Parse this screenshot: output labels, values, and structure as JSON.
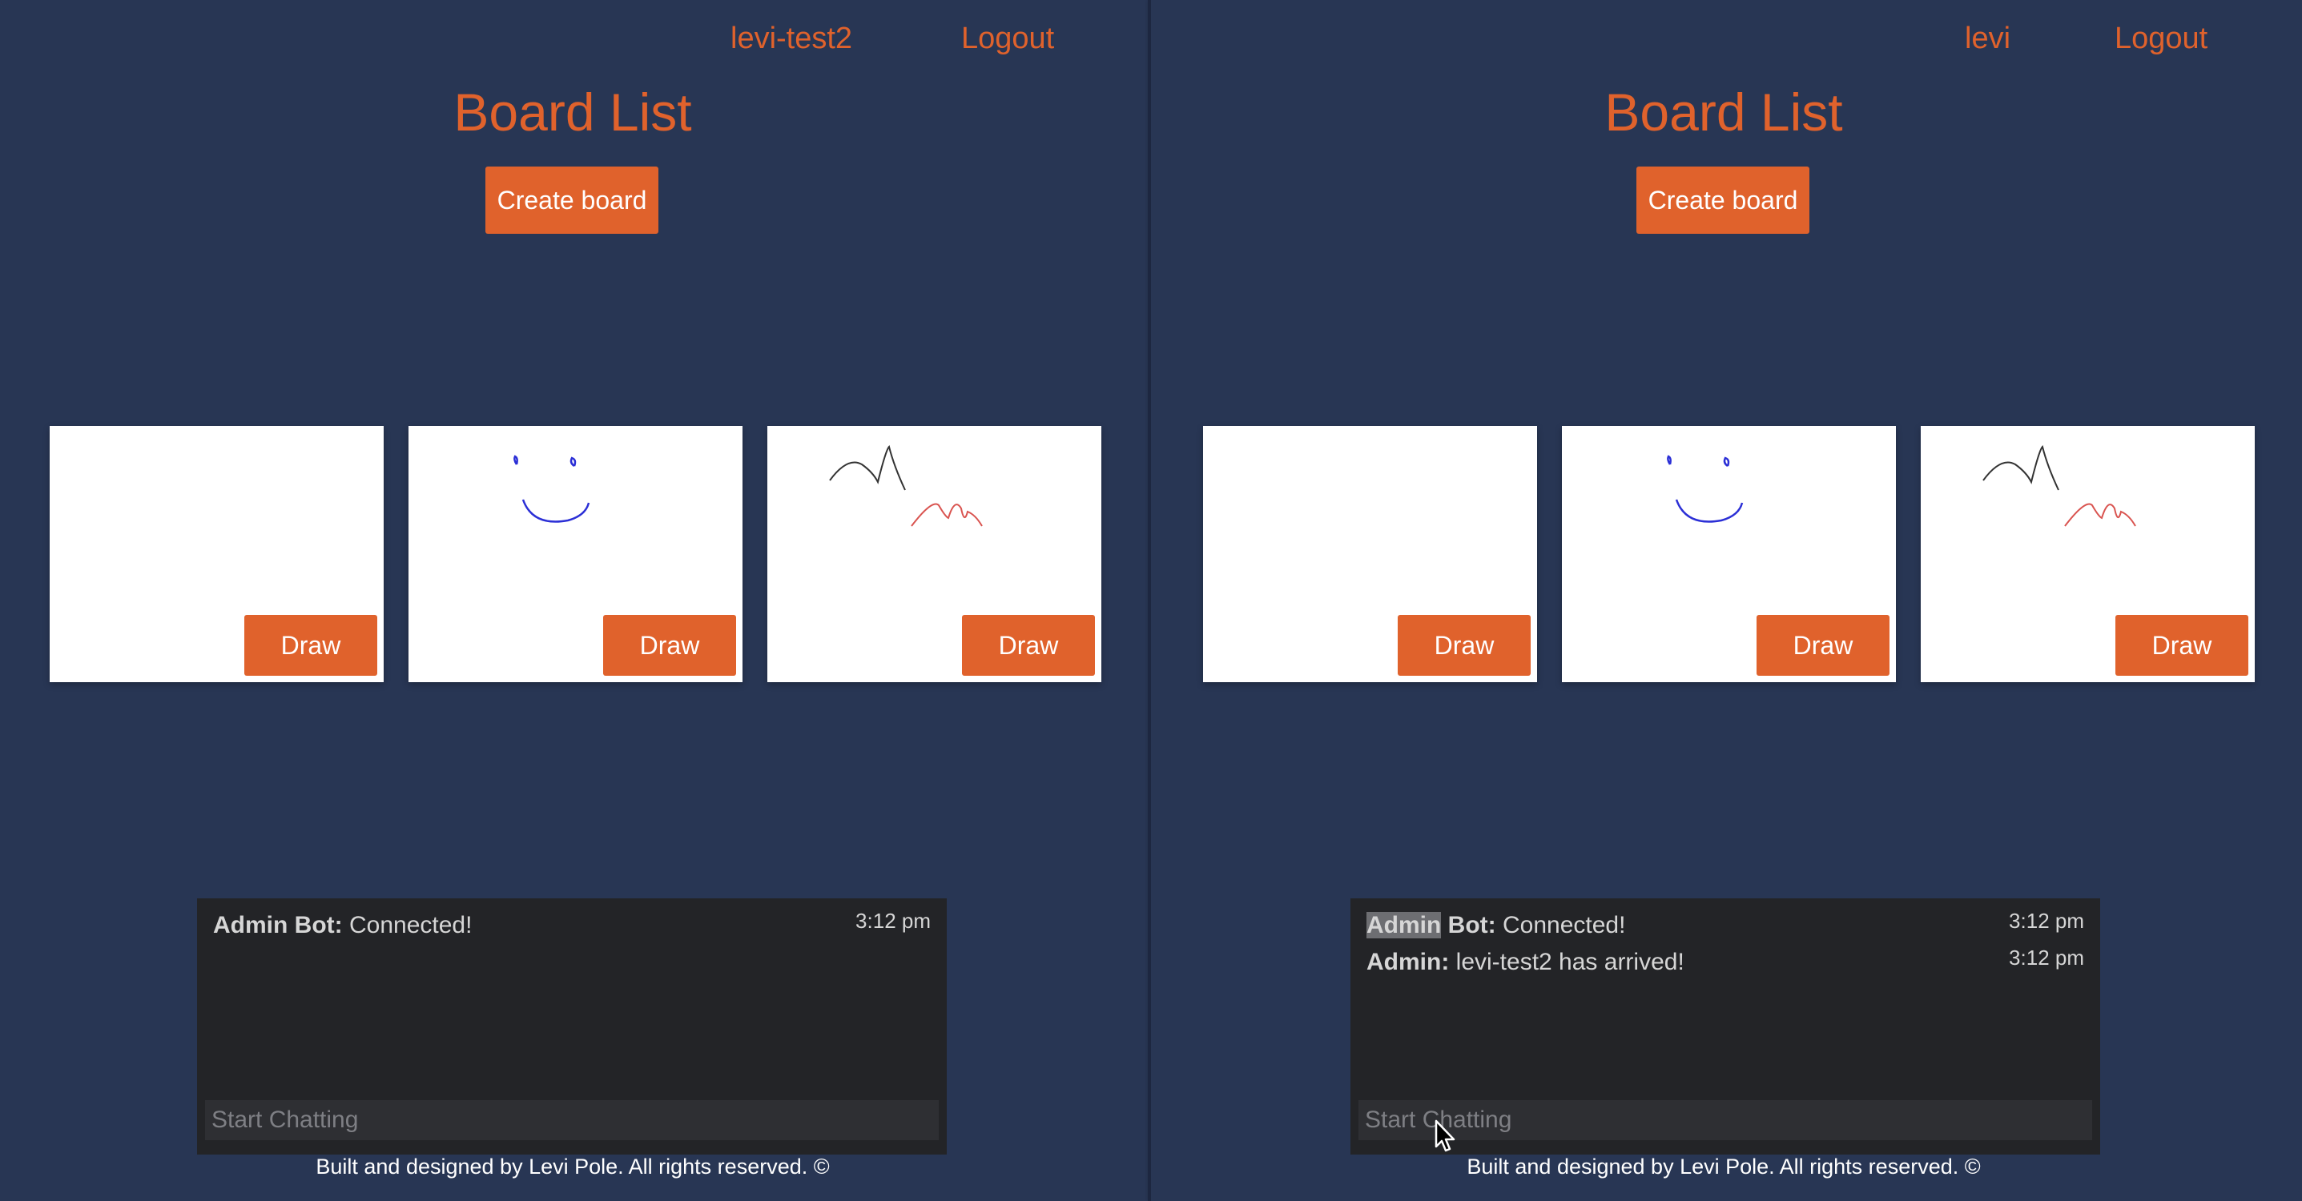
{
  "windows": [
    {
      "nav": {
        "username": "levi-test2",
        "logout": "Logout"
      },
      "title": "Board List",
      "create_button": "Create board",
      "boards": [
        {
          "draw_label": "Draw",
          "sketch": "blank"
        },
        {
          "draw_label": "Draw",
          "sketch": "smiley"
        },
        {
          "draw_label": "Draw",
          "sketch": "scribbles"
        }
      ],
      "chat": {
        "messages": [
          {
            "sender": "Admin Bot:",
            "text": "Connected!",
            "time": "3:12 pm"
          }
        ],
        "input_placeholder": "Start Chatting"
      },
      "footer": "Built and designed by Levi Pole. All rights reserved. ©"
    },
    {
      "nav": {
        "username": "levi",
        "logout": "Logout"
      },
      "title": "Board List",
      "create_button": "Create board",
      "boards": [
        {
          "draw_label": "Draw",
          "sketch": "blank"
        },
        {
          "draw_label": "Draw",
          "sketch": "smiley"
        },
        {
          "draw_label": "Draw",
          "sketch": "scribbles"
        }
      ],
      "chat": {
        "messages": [
          {
            "sender_highlight": "Admin",
            "sender": " Bot:",
            "text": "Connected!",
            "time": "3:12 pm"
          },
          {
            "sender": "Admin:",
            "text": "levi-test2 has arrived!",
            "time": "3:12 pm"
          }
        ],
        "input_placeholder": "Start Chatting"
      },
      "footer": "Built and designed by Levi Pole. All rights reserved. ©"
    }
  ],
  "colors": {
    "background": "#283654",
    "accent": "#e0622c",
    "chat_background": "#232427",
    "smiley_stroke": "#2b2fd6",
    "scribble_dark": "#333333",
    "scribble_red": "#d9534f"
  },
  "cursor": "arrow-pointer-icon"
}
